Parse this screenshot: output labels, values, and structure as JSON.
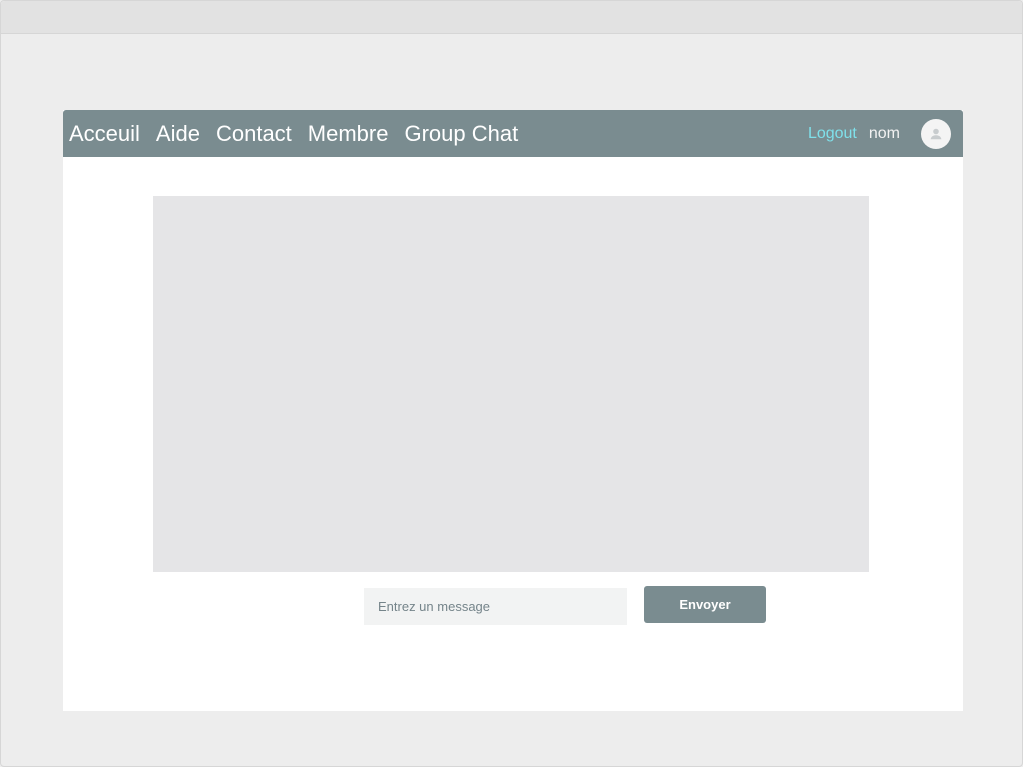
{
  "navbar": {
    "links": [
      {
        "label": "Acceuil"
      },
      {
        "label": "Aide"
      },
      {
        "label": "Contact"
      },
      {
        "label": "Membre"
      },
      {
        "label": "Group Chat"
      }
    ],
    "logout_label": "Logout",
    "user_name": "nom",
    "avatar_icon": "user-icon"
  },
  "chat": {
    "input_placeholder": "Entrez un message",
    "input_value": "",
    "send_label": "Envoyer"
  },
  "colors": {
    "navbar_bg": "#7a8c90",
    "logout_accent": "#7fe0ea",
    "chat_area_bg": "#e5e5e7",
    "page_bg": "#ededed"
  }
}
